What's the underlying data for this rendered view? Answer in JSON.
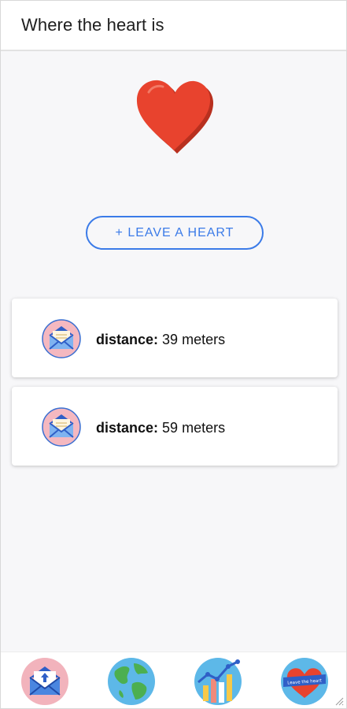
{
  "header": {
    "title": "Where the heart is"
  },
  "leave_button": {
    "label": "+ LEAVE A HEART"
  },
  "cards": [
    {
      "label": "distance:",
      "value": "39 meters"
    },
    {
      "label": "distance:",
      "value": "59 meters"
    }
  ],
  "bottom_nav": {
    "items": [
      {
        "icon": "envelope-icon"
      },
      {
        "icon": "globe-icon"
      },
      {
        "icon": "chart-icon"
      },
      {
        "icon": "heart-banner-icon",
        "banner_text": "Leave the heart"
      }
    ]
  },
  "colors": {
    "accent": "#3b7be8",
    "heart": "#e8432e",
    "heart_shadow": "#b8301f"
  }
}
